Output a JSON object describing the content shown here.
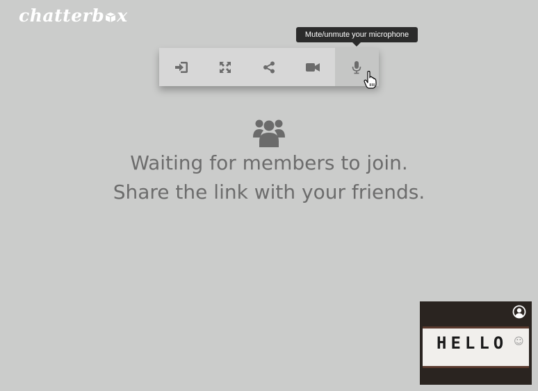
{
  "app": {
    "logo_left": "chatterb",
    "logo_right": "x"
  },
  "tooltip": {
    "text": "Mute/unmute your microphone"
  },
  "toolbar": {
    "buttons": [
      {
        "icon": "leave-icon",
        "tooltip": ""
      },
      {
        "icon": "fullscreen-icon",
        "tooltip": ""
      },
      {
        "icon": "share-icon",
        "tooltip": ""
      },
      {
        "icon": "camera-icon",
        "tooltip": ""
      },
      {
        "icon": "microphone-icon",
        "tooltip": "Mute/unmute your microphone"
      }
    ],
    "active_index": 4
  },
  "waiting": {
    "line1": "Waiting for members to join.",
    "line2": "Share the link with your friends."
  },
  "preview": {
    "sign_text": "HELLO",
    "smiley": "☺"
  },
  "colors": {
    "background": "#cbcccb",
    "toolbar": "#d7d7d7",
    "icon": "#6b6b6b",
    "text": "#6c6c6c",
    "tooltip_bg": "#2b2b2b"
  }
}
